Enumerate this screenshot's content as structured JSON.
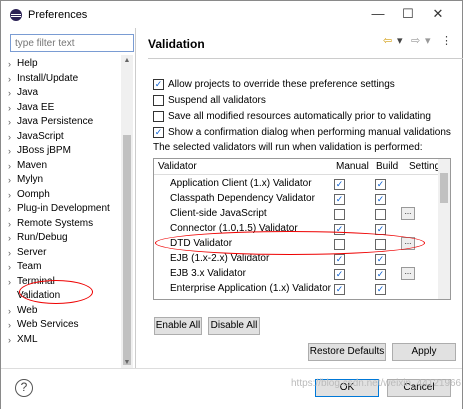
{
  "window": {
    "title": "Preferences",
    "minimize": "—",
    "maximize": "☐",
    "close": "✕"
  },
  "sidebar": {
    "filter_placeholder": "type filter text",
    "items": [
      {
        "label": "Help",
        "arrow": "›"
      },
      {
        "label": "Install/Update",
        "arrow": "›"
      },
      {
        "label": "Java",
        "arrow": "›"
      },
      {
        "label": "Java EE",
        "arrow": "›"
      },
      {
        "label": "Java Persistence",
        "arrow": "›"
      },
      {
        "label": "JavaScript",
        "arrow": "›"
      },
      {
        "label": "JBoss jBPM",
        "arrow": "›"
      },
      {
        "label": "Maven",
        "arrow": "›"
      },
      {
        "label": "Mylyn",
        "arrow": "›"
      },
      {
        "label": "Oomph",
        "arrow": "›"
      },
      {
        "label": "Plug-in Development",
        "arrow": "›"
      },
      {
        "label": "Remote Systems",
        "arrow": "›"
      },
      {
        "label": "Run/Debug",
        "arrow": "›"
      },
      {
        "label": "Server",
        "arrow": "›"
      },
      {
        "label": "Team",
        "arrow": "›"
      },
      {
        "label": "Terminal",
        "arrow": "›"
      },
      {
        "label": "Validation",
        "arrow": ""
      },
      {
        "label": "Web",
        "arrow": "›"
      },
      {
        "label": "Web Services",
        "arrow": "›"
      },
      {
        "label": "XML",
        "arrow": "›"
      }
    ]
  },
  "main": {
    "heading": "Validation",
    "nav": {
      "back": "⇦",
      "back_menu": "▾",
      "forward": "⇨",
      "forward_menu": "▾",
      "menu": "⋮"
    },
    "options": [
      {
        "label": "Allow projects to override these preference settings",
        "checked": "✓"
      },
      {
        "label": "Suspend all validators",
        "checked": ""
      },
      {
        "label": "Save all modified resources automatically prior to validating",
        "checked": ""
      },
      {
        "label": "Show a confirmation dialog when performing manual validations",
        "checked": "✓"
      }
    ],
    "info": "The selected validators will run when validation is performed:",
    "table": {
      "headers": [
        "Validator",
        "Manual",
        "Build",
        "Setting"
      ],
      "rows": [
        {
          "name": "Application Client (1.x) Validator",
          "manual": "✓",
          "build": "✓",
          "settings": ""
        },
        {
          "name": "Classpath Dependency Validator",
          "manual": "✓",
          "build": "✓",
          "settings": ""
        },
        {
          "name": "Client-side JavaScript",
          "manual": "",
          "build": "",
          "settings": "..."
        },
        {
          "name": "Connector (1.0,1.5) Validator",
          "manual": "✓",
          "build": "✓",
          "settings": ""
        },
        {
          "name": "DTD Validator",
          "manual": "",
          "build": "",
          "settings": "..."
        },
        {
          "name": "EJB (1.x-2.x) Validator",
          "manual": "✓",
          "build": "✓",
          "settings": ""
        },
        {
          "name": "EJB 3.x Validator",
          "manual": "✓",
          "build": "✓",
          "settings": "..."
        },
        {
          "name": "Enterprise Application (1.x) Validator",
          "manual": "✓",
          "build": "✓",
          "settings": ""
        }
      ]
    },
    "enable_all": "Enable All",
    "disable_all": "Disable All",
    "restore_defaults": "Restore Defaults",
    "apply": "Apply"
  },
  "footer": {
    "help": "?",
    "ok": "OK",
    "cancel": "Cancel"
  },
  "watermark": "https://blog.csdn.net/weixin_44121966",
  "colors": {
    "highlight": "#e00000",
    "filter_border": "#7a9cd3",
    "check": "#0b5fd1"
  }
}
